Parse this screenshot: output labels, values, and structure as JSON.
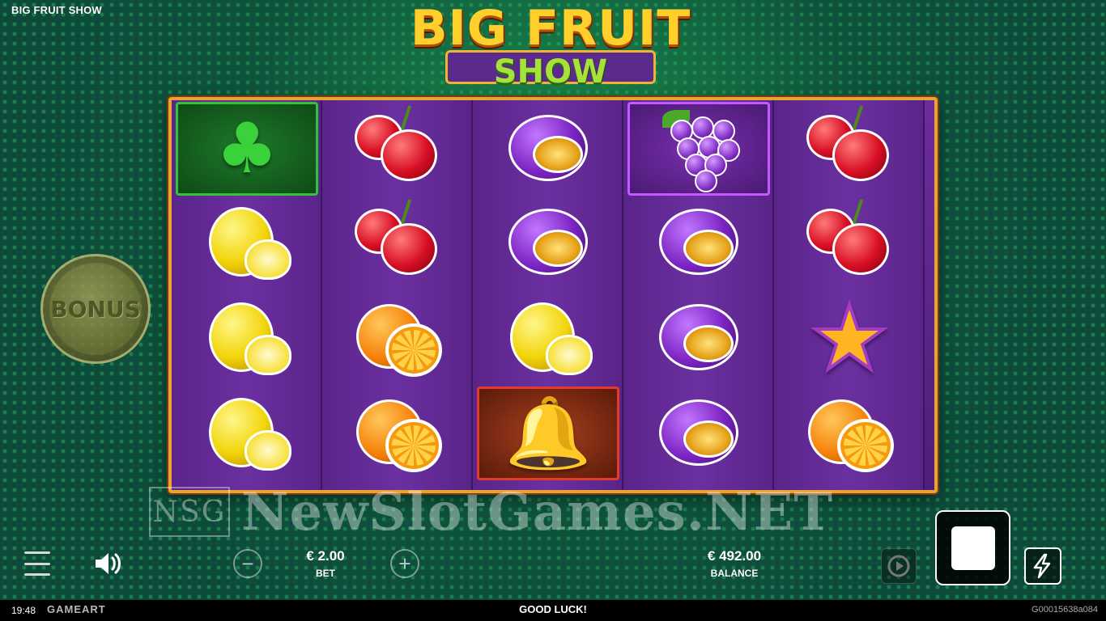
{
  "header": {
    "game_title": "BIG FRUIT SHOW"
  },
  "logo": {
    "line1": "BIG FRUIT",
    "line2": "SHOW"
  },
  "bonus": {
    "label": "BONUS"
  },
  "reels": [
    [
      "clover",
      "lemon",
      "lemon",
      "lemon"
    ],
    [
      "cherry",
      "cherry",
      "orange",
      "orange"
    ],
    [
      "plum",
      "plum",
      "lemon",
      "bell"
    ],
    [
      "grapes",
      "plum",
      "plum",
      "plum"
    ],
    [
      "cherry",
      "cherry",
      "star",
      "orange"
    ]
  ],
  "highlights": [
    {
      "reel": 0,
      "row": 0,
      "color": "green"
    },
    {
      "reel": 3,
      "row": 0,
      "color": "purple"
    },
    {
      "reel": 2,
      "row": 3,
      "color": "red"
    }
  ],
  "watermark": {
    "box": "NSG",
    "text": "NewSlotGames.NET"
  },
  "controls": {
    "bet_value": "€ 2.00",
    "bet_label": "BET",
    "balance_value": "€ 492.00",
    "balance_label": "BALANCE",
    "icons": [
      "menu-icon",
      "sound-icon",
      "minus-icon",
      "plus-icon",
      "autoplay-icon",
      "stop-icon",
      "turbo-icon"
    ]
  },
  "footer": {
    "time": "19:48",
    "provider": "GAMEART",
    "message": "GOOD LUCK!",
    "game_id": "G00015638a084"
  },
  "colors": {
    "accent_gold": "#e8a432",
    "reel_purple": "#5a2489",
    "background_green": "#0d4a3a"
  }
}
